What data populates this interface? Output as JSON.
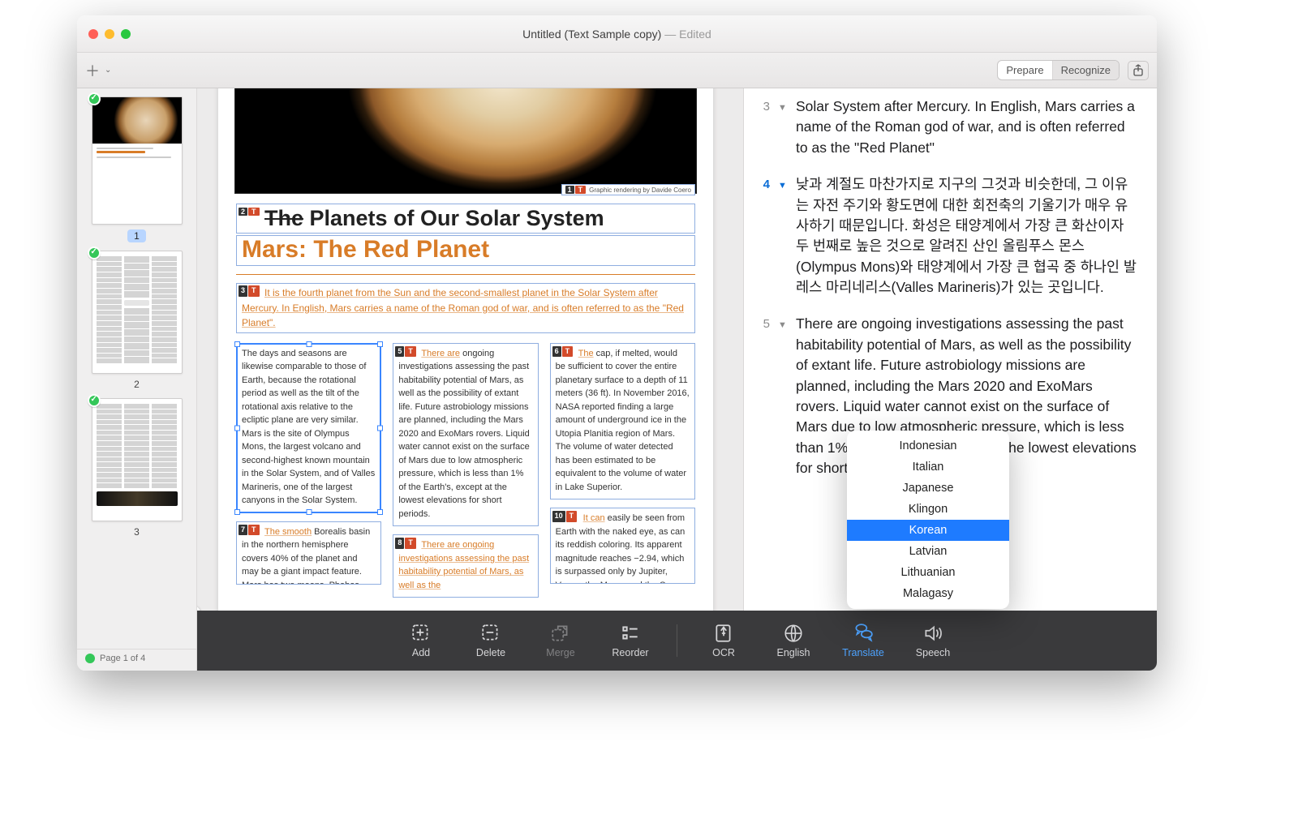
{
  "window": {
    "title": "Untitled (Text Sample copy)",
    "status": "  —  Edited"
  },
  "toolbar": {
    "prepare": "Prepare",
    "recognize": "Recognize"
  },
  "sidebar": {
    "pages": [
      "1",
      "2",
      "3"
    ],
    "footer": "Page 1 of 4"
  },
  "doc": {
    "credit": "Graphic rendering by Davide Coero",
    "h1_prefix": "The",
    "h1_rest": " Planets of Our Solar System",
    "h2": "Mars: The Red Planet",
    "intro_lead": "It is",
    "intro": " the fourth planet from the Sun and the second-smallest planet in the Solar System after Mercury. In English, Mars carries a name of the Roman god of war, and is often referred to as the \"Red Planet\".",
    "blk4": "The days and seasons are likewise comparable to those of Earth, because the rotational period as well as the tilt of the rotational axis relative to the ecliptic plane are very similar. Mars is the site of Olympus Mons, the largest volcano and second-highest known mountain in the Solar System, and of Valles Marineris, one of the largest canyons in the Solar System.",
    "blk5_lead": "There are",
    "blk5": " ongoing investigations assessing the past habitability potential of Mars, as well as the possibility of extant life. Future astrobiology missions are planned, including the Mars 2020 and ExoMars rovers. Liquid water cannot exist on the surface of Mars due to low atmospheric pressure, which is less than 1% of the Earth's, except at the lowest elevations for short periods.",
    "blk6_lead": "The",
    "blk6": " cap, if melted, would be sufficient to cover the entire planetary surface to a depth of 11 meters (36 ft). In November 2016, NASA reported finding a large amount of underground ice in the Utopia Planitia region of Mars. The volume of water detected has been estimated to be equivalent to the volume of water in Lake Superior.",
    "blk7_lead": "The smooth",
    "blk7": " Borealis basin in the northern hemisphere covers 40% of the planet and may be a giant impact feature. Mars has two moons, Phobos and Deimos,",
    "blk8_lead": "There",
    "blk8": " are ongoing investigations assessing the past habitability potential of Mars, as well as the",
    "blk10_lead": "It can",
    "blk10": " easily be seen from Earth with the naked eye, as can its reddish coloring. Its apparent magnitude reaches −2.94, which is surpassed only by Jupiter, Venus, the Moon, and the Sun."
  },
  "panel": {
    "e3": "Solar System after Mercury. In English, Mars carries a name of the Roman god of war, and is often referred to as the \"Red Planet\"",
    "e4": "낮과 계절도 마찬가지로 지구의 그것과 비슷한데, 그 이유는 자전 주기와 황도면에 대한 회전축의 기울기가 매우 유사하기 때문입니다. 화성은 태양계에서 가장 큰 화산이자 두 번째로 높은 것으로 알려진 산인 올림푸스 몬스(Olympus Mons)와 태양계에서 가장 큰 협곡 중 하나인 발레스 마리네리스(Valles Marineris)가 있는 곳입니다.",
    "e5": "There are ongoing investigations assessing the past habitability potential of Mars, as well as the possibility of extant life. Future astrobiology missions are planned, including the Mars 2020 and ExoMars rovers. Liquid water cannot exist on the surface of Mars due to low atmospheric pressure, which is less than 1% of the Earth's, except at the lowest elevations for short periods."
  },
  "popup": {
    "items": [
      "Indonesian",
      "Italian",
      "Japanese",
      "Klingon",
      "Korean",
      "Latvian",
      "Lithuanian",
      "Malagasy"
    ],
    "selected": "Korean"
  },
  "bbar": {
    "add": "Add",
    "delete": "Delete",
    "merge": "Merge",
    "reorder": "Reorder",
    "ocr": "OCR",
    "english": "English",
    "translate": "Translate",
    "speech": "Speech"
  },
  "nums": {
    "n1": "1",
    "n2": "2",
    "n3": "3",
    "n4": "4",
    "n5": "5",
    "n6": "6",
    "n7": "7",
    "n8": "8",
    "n10": "10",
    "t": "T"
  }
}
